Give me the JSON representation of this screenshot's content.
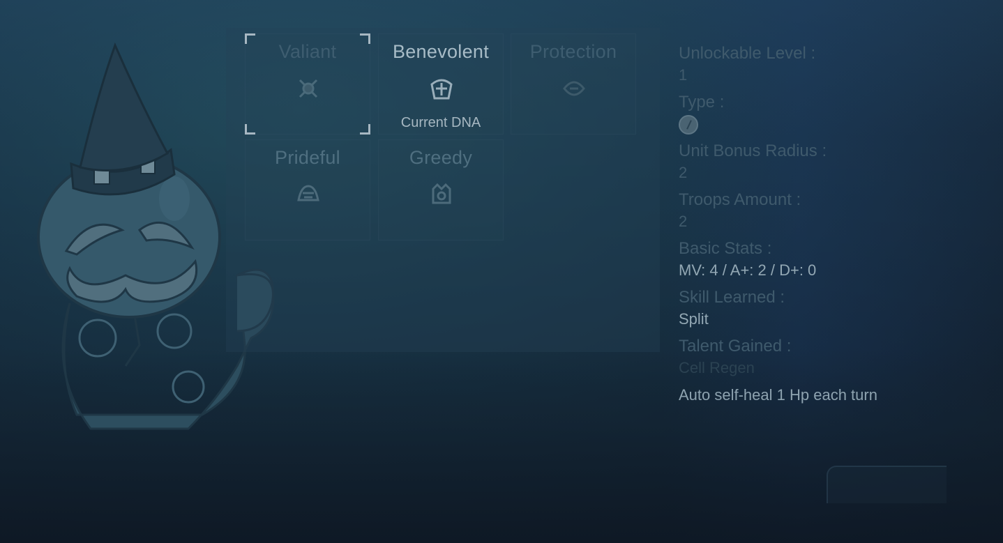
{
  "dna_options": [
    {
      "label": "Valiant",
      "selected": true,
      "icon": "valiant-emblem-icon"
    },
    {
      "label": "Benevolent",
      "current": true,
      "sub": "Current DNA",
      "icon": "benevolent-emblem-icon"
    },
    {
      "label": "Protection",
      "icon": "protection-emblem-icon"
    },
    {
      "label": "Prideful",
      "icon": "prideful-emblem-icon"
    },
    {
      "label": "Greedy",
      "icon": "greedy-emblem-icon"
    }
  ],
  "info": {
    "unlockable_level_label": "Unlockable Level :",
    "unlockable_level_value": "1",
    "type_label": "Type :",
    "type_icon": "compass-icon",
    "radius_label": "Unit Bonus Radius :",
    "radius_value": "2",
    "troops_label": "Troops Amount :",
    "troops_value": "2",
    "stats_label": "Basic Stats :",
    "stats_value": "MV: 4 / A+: 2 / D+: 0",
    "skill_label": "Skill Learned :",
    "skill_value": "Split",
    "talent_label": "Talent Gained :",
    "talent_value": "Cell Regen",
    "talent_desc": "Auto self-heal 1 Hp each turn"
  },
  "colors": {
    "background": "#1b3a4e",
    "text_dim": "#3f5a6c",
    "text_bright": "#a8bcc7",
    "selection_bracket": "#a7b7c2"
  }
}
